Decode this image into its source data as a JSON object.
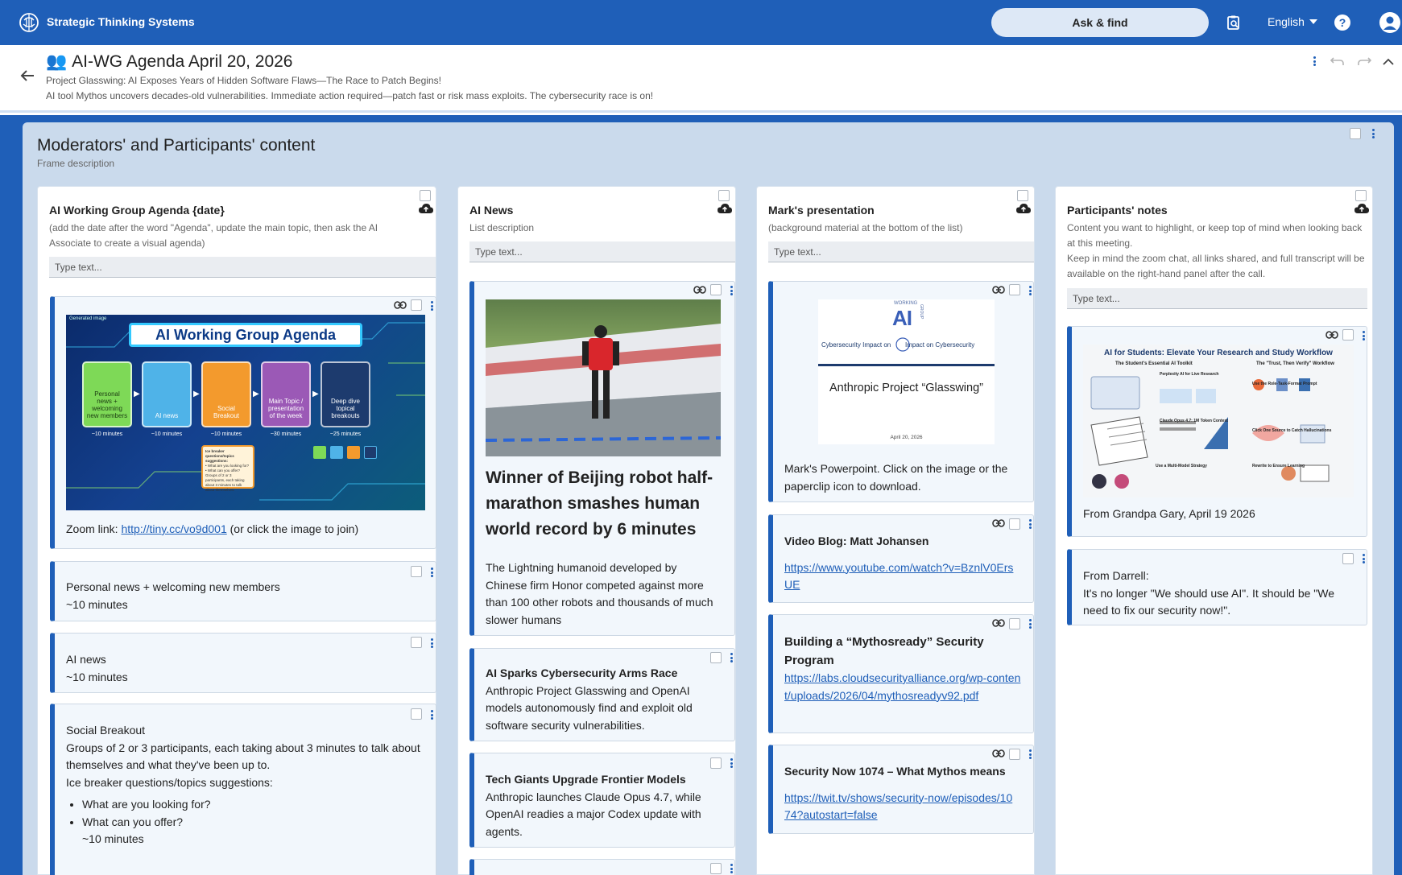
{
  "app": {
    "title": "Strategic Thinking Systems",
    "ask_find": "Ask & find",
    "language": "English"
  },
  "board": {
    "emoji": "👥",
    "title": "AI-WG Agenda April 20, 2026",
    "subtitle": "Project Glasswing: AI Exposes Years of Hidden Software Flaws—The Race to Patch Begins!",
    "description": "AI tool Mythos uncovers decades-old vulnerabilities. Immediate action required—patch fast or risk mass exploits. The cybersecurity race is on!"
  },
  "frame": {
    "title": "Moderators' and Participants' content",
    "description": "Frame description"
  },
  "lists": [
    {
      "title": "AI Working Group Agenda {date}",
      "description": "(add the date after the word \"Agenda\", update the main topic, then ask the AI Associate to create a visual agenda)",
      "input_placeholder": "Type text...",
      "agenda_image": {
        "corner_label": "Generated image",
        "title": "AI Working Group Agenda",
        "boxes": [
          {
            "label": "Personal news + welcoming new members",
            "time": "~10 minutes",
            "color": "#7ed957"
          },
          {
            "label": "AI news",
            "time": "~10 minutes",
            "color": "#4fb3e8"
          },
          {
            "label": "Social Breakout",
            "time": "~10 minutes",
            "color": "#f39a2d"
          },
          {
            "label": "Main Topic / presentation of the week",
            "time": "~30 minutes",
            "color": "#9b59b6"
          },
          {
            "label": "Deep dive topical breakouts",
            "time": "~25 minutes",
            "color": "#1d3b6e"
          }
        ],
        "note_title": "Ice breaker questions/topics suggestions:",
        "note_lines": [
          "• What are you looking for?",
          "• What can you offer?"
        ],
        "note_footer": "Groups of 2 or 3 participants, each taking about 3 minutes to talk about themselves."
      },
      "zoom_prefix": "Zoom link: ",
      "zoom_link": "http://tiny.cc/vo9d001",
      "zoom_suffix": " (or click the image to join)",
      "cards": [
        {
          "line1": "Personal news + welcoming new members",
          "line2": "~10 minutes"
        },
        {
          "line1": "AI news",
          "line2": "~10 minutes"
        },
        {
          "line1": "Social Breakout",
          "line2": "Groups of 2 or 3 participants, each taking about 3 minutes to talk about themselves and what they've been up to.",
          "line3": "Ice breaker questions/topics suggestions:",
          "bullets": [
            "What are you looking for?",
            "What can you offer?"
          ],
          "footer": "~10 minutes"
        }
      ]
    },
    {
      "title": "AI News",
      "description": "List description",
      "input_placeholder": "Type text...",
      "feature": {
        "headline": "Winner of Beijing robot half-marathon smashes human world record by 6 minutes",
        "body": "The Lightning humanoid developed by Chinese firm Honor competed against more than 100 other robots and thousands of much slower humans"
      },
      "cards": [
        {
          "title": "AI Sparks Cybersecurity Arms Race",
          "body": "Anthropic Project Glasswing and OpenAI models autonomously find and exploit old software security vulnerabilities."
        },
        {
          "title": "Tech Giants Upgrade Frontier Models",
          "body": "Anthropic launches Claude Opus 4.7, while OpenAI readies a major Codex update with agents."
        }
      ]
    },
    {
      "title": "Mark's presentation",
      "description": "(background material at the bottom of the list)",
      "input_placeholder": "Type text...",
      "slide": {
        "logo_top": "WORKING",
        "logo_ai": "AI",
        "logo_side": "GROUP",
        "left_text": "Cybersecurity Impact on",
        "right_text": "Impact on Cybersecurity",
        "title": "Anthropic Project “Glasswing”",
        "date": "April 20, 2026"
      },
      "slide_caption": "Mark's Powerpoint. Click on the image or the paperclip icon to download.",
      "cards": [
        {
          "title": "Video Blog: Matt Johansen",
          "link": "https://www.youtube.com/watch?v=BznlV0ErsUE"
        },
        {
          "title": "Building a “Mythosready” Security Program",
          "link": "https://labs.cloudsecurityalliance.org/wp-content/uploads/2026/04/mythosreadyv92.pdf"
        },
        {
          "title": "Security Now 1074 – What Mythos means",
          "link": "https://twit.tv/shows/security-now/episodes/1074?autostart=false"
        }
      ]
    },
    {
      "title": "Participants' notes",
      "description_1": "Content you want to highlight, or keep top of mind when looking back at this meeting.",
      "description_2": "Keep in mind the zoom chat, all links shared, and full transcript will be available on the right-hand panel after the call.",
      "input_placeholder": "Type text...",
      "infographic": {
        "title": "AI for Students: Elevate Your Research and Study Workflow",
        "left_header": "The Student's Essential AI Toolkit",
        "right_header": "The \"Trust, Then Verify\" Workflow",
        "items": [
          "Perplexity AI for Live Research",
          "Claude Opus 4.7: 1M Token Context",
          "Use a Multi-Model Strategy",
          "Use the Role-Task-Format Prompt",
          "Click One Source to Catch Hallucinations",
          "Rewrite to Ensure Learning"
        ]
      },
      "infographic_caption": "From Grandpa Gary, April 19 2026",
      "cards": [
        {
          "line1": "From Darrell:",
          "line2": "It's no longer \"We should use AI\". It should be \"We need to fix our security now!\"."
        }
      ]
    }
  ],
  "colors": {
    "brand_blue": "#1f5fb8",
    "frame_bg": "#cadaec",
    "card_bg": "#f2f7fc"
  }
}
